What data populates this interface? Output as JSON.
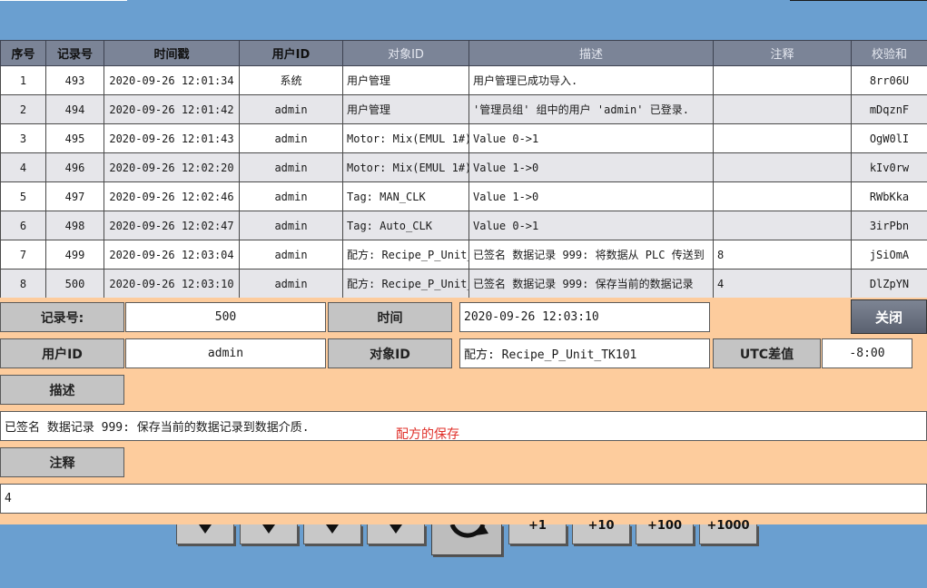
{
  "table": {
    "headers": [
      "序号",
      "记录号",
      "时间戳",
      "用户ID",
      "对象ID",
      "描述",
      "注释",
      "校验和"
    ],
    "rows": [
      [
        "1",
        "493",
        "2020-09-26 12:01:34",
        "系统",
        "用户管理",
        "用户管理已成功导入.",
        "",
        "8rr06U"
      ],
      [
        "2",
        "494",
        "2020-09-26 12:01:42",
        "admin",
        "用户管理",
        "'管理员组' 组中的用户 'admin' 已登录.",
        "",
        "mDqznF"
      ],
      [
        "3",
        "495",
        "2020-09-26 12:01:43",
        "admin",
        "Motor: Mix(EMUL 1#)",
        "Value 0->1",
        "",
        "OgW0lI"
      ],
      [
        "4",
        "496",
        "2020-09-26 12:02:20",
        "admin",
        "Motor: Mix(EMUL 1#)",
        "Value 1->0",
        "",
        "kIv0rw"
      ],
      [
        "5",
        "497",
        "2020-09-26 12:02:46",
        "admin",
        "Tag: MAN_CLK",
        "Value 1->0",
        "",
        "RWbKka"
      ],
      [
        "6",
        "498",
        "2020-09-26 12:02:47",
        "admin",
        "Tag: Auto_CLK",
        "Value 0->1",
        "",
        "3irPbn"
      ],
      [
        "7",
        "499",
        "2020-09-26 12:03:04",
        "admin",
        "配方: Recipe_P_Unit_",
        "已签名 数据记录 999: 将数据从 PLC 传送到",
        "8",
        "jSiOmA"
      ],
      [
        "8",
        "500",
        "2020-09-26 12:03:10",
        "admin",
        "配方: Recipe_P_Unit_",
        "已签名 数据记录 999:  保存当前的数据记录",
        "4",
        "DlZpYN"
      ]
    ]
  },
  "detail": {
    "record_label": "记录号:",
    "record_value": "500",
    "time_label": "时间",
    "time_value": "2020-09-26 12:03:10",
    "close_label": "关闭",
    "user_label": "用户ID",
    "user_value": "admin",
    "object_label": "对象ID",
    "object_value": "配方: Recipe_P_Unit_TK101",
    "utc_label": "UTC差值",
    "utc_value": "-8:00",
    "desc_label": "描述",
    "desc_value": "已签名 数据记录 999:  保存当前的数据记录到数据介质.",
    "desc_note_red": "配方的保存",
    "comment_label": "注释",
    "comment_value": "4"
  },
  "nav": {
    "plus1": "+1",
    "plus10": "+10",
    "plus100": "+100",
    "plus1000": "+1000"
  }
}
